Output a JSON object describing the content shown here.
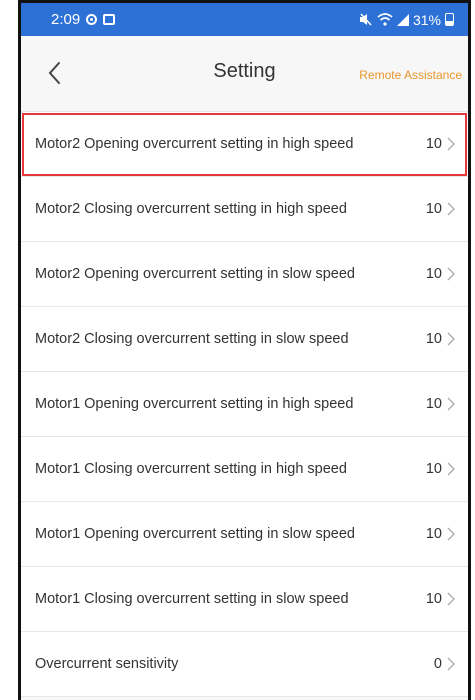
{
  "status_bar": {
    "time": "2:09",
    "battery": "31%",
    "icons": [
      "vpn-key-icon",
      "photo-icon",
      "mute-icon",
      "wifi-icon",
      "signal-icon",
      "battery-icon"
    ]
  },
  "header": {
    "title": "Setting",
    "back_icon": "chevron-left-icon",
    "remote_assistance": "Remote Assistance"
  },
  "colors": {
    "status_bar": "#2d71d6",
    "accent": "#e8962d",
    "highlight_border": "#e53a3a"
  },
  "settings": [
    {
      "label": "Motor2 Opening overcurrent setting in high speed",
      "value": "10",
      "highlighted": true
    },
    {
      "label": "Motor2 Closing overcurrent setting in high speed",
      "value": "10"
    },
    {
      "label": "Motor2 Opening overcurrent setting in slow speed",
      "value": "10"
    },
    {
      "label": "Motor2 Closing overcurrent setting in slow speed",
      "value": "10"
    },
    {
      "label": "Motor1 Opening overcurrent setting in high speed",
      "value": "10"
    },
    {
      "label": "Motor1 Closing overcurrent setting in high speed",
      "value": "10"
    },
    {
      "label": "Motor1 Opening overcurrent setting in slow speed",
      "value": "10"
    },
    {
      "label": "Motor1 Closing overcurrent setting in slow speed",
      "value": "10"
    },
    {
      "label": "Overcurrent sensitivity",
      "value": "0"
    }
  ]
}
